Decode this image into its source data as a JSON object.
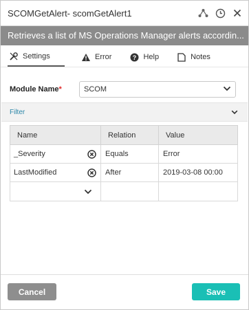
{
  "window": {
    "title": "SCOMGetAlert-  scomGetAlert1",
    "icons": [
      "network-icon",
      "clock-icon",
      "close-icon"
    ]
  },
  "description": "Retrieves a list of MS Operations Manager alerts accordin...",
  "tabs": [
    {
      "label": "Settings",
      "icon": "settings-icon",
      "active": true
    },
    {
      "label": "Error",
      "icon": "warning-icon",
      "active": false
    },
    {
      "label": "Help",
      "icon": "help-icon",
      "active": false
    },
    {
      "label": "Notes",
      "icon": "notes-icon",
      "active": false
    }
  ],
  "module": {
    "label": "Module Name",
    "required_mark": "*",
    "value": "SCOM"
  },
  "filter": {
    "label": "Filter",
    "columns": [
      "Name",
      "Relation",
      "Value"
    ],
    "rows": [
      {
        "name": "_Severity",
        "relation": "Equals",
        "value": "Error"
      },
      {
        "name": "LastModified",
        "relation": "After",
        "value": "2019-03-08 00:00"
      }
    ]
  },
  "footer": {
    "cancel_label": "Cancel",
    "save_label": "Save"
  },
  "colors": {
    "description_bg": "#8b8b8b",
    "save": "#1abfb5",
    "cancel": "#8e8e8e",
    "required": "#e02a2a",
    "filter_link": "#2a86a8"
  }
}
